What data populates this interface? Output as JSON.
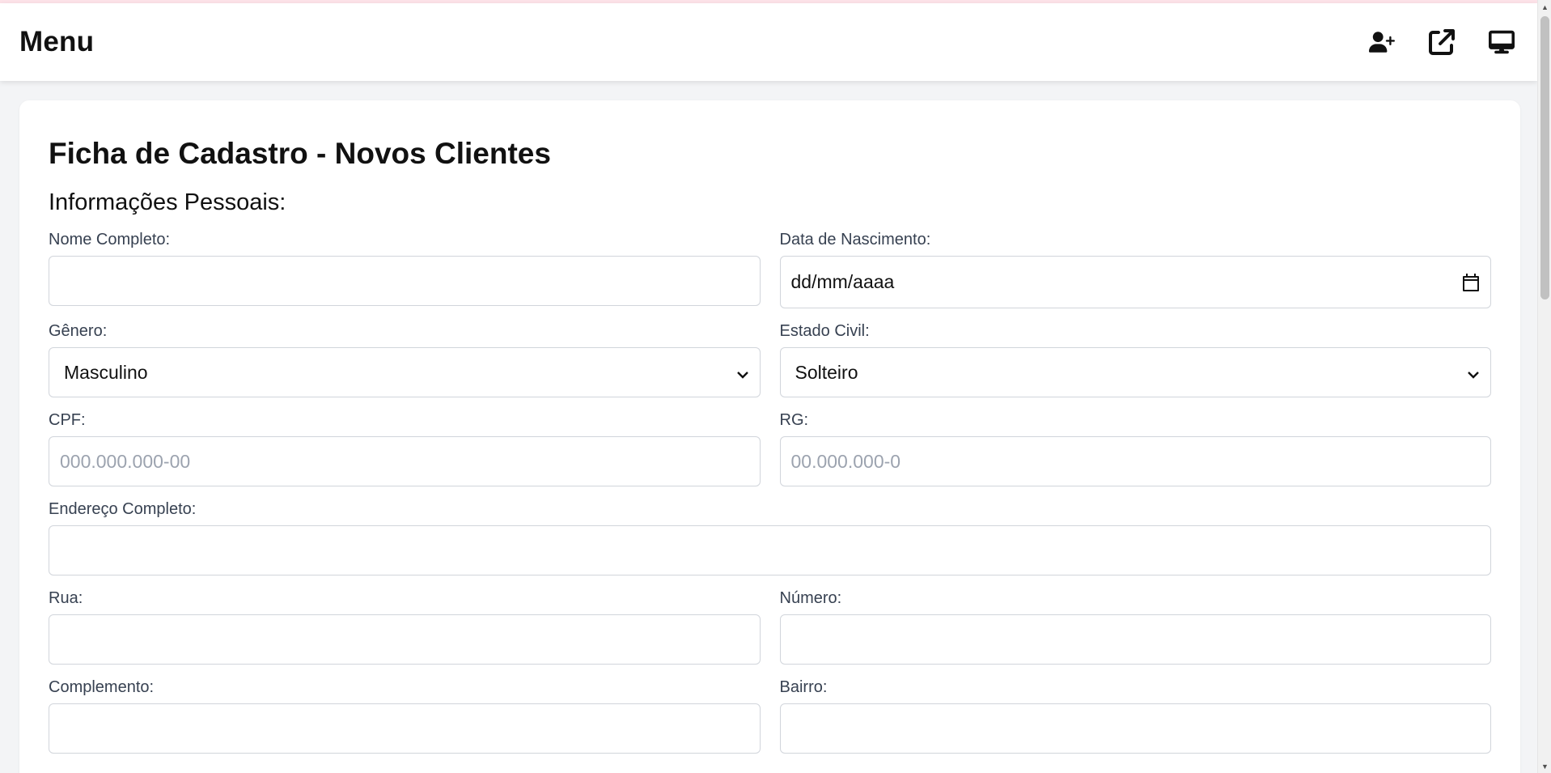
{
  "navbar": {
    "title": "Menu",
    "icons": [
      "user-plus-icon",
      "external-link-icon",
      "monitor-icon"
    ]
  },
  "form": {
    "title": "Ficha de Cadastro - Novos Clientes",
    "section_personal": "Informações Pessoais:",
    "nome_completo": {
      "label": "Nome Completo:",
      "value": ""
    },
    "data_nascimento": {
      "label": "Data de Nascimento:",
      "value": "dd/mm/aaaa"
    },
    "genero": {
      "label": "Gênero:",
      "selected": "Masculino"
    },
    "estado_civil": {
      "label": "Estado Civil:",
      "selected": "Solteiro"
    },
    "cpf": {
      "label": "CPF:",
      "placeholder": "000.000.000-00",
      "value": ""
    },
    "rg": {
      "label": "RG:",
      "placeholder": "00.000.000-0",
      "value": ""
    },
    "endereco": {
      "label": "Endereço Completo:",
      "value": ""
    },
    "rua": {
      "label": "Rua:",
      "value": ""
    },
    "numero": {
      "label": "Número:",
      "value": ""
    },
    "complemento": {
      "label": "Complemento:",
      "value": ""
    },
    "bairro": {
      "label": "Bairro:",
      "value": ""
    }
  }
}
